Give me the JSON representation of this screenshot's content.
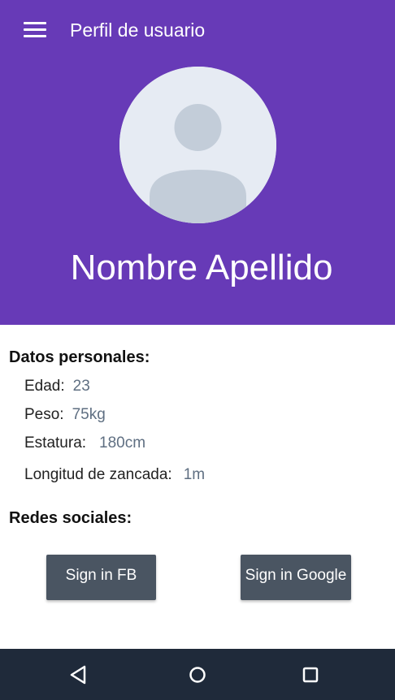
{
  "app_bar": {
    "title": "Perfil de usuario",
    "menu_icon": "hamburger-menu-icon"
  },
  "profile": {
    "name": "Nombre Apellido",
    "avatar_icon": "default-user-avatar-icon"
  },
  "personal": {
    "heading": "Datos personales:",
    "fields": [
      {
        "label": "Edad:",
        "value": "23"
      },
      {
        "label": "Peso:",
        "value": "75kg"
      },
      {
        "label": "Estatura:",
        "value": "180cm"
      },
      {
        "label": "Longitud de zancada:",
        "value": "1m"
      }
    ]
  },
  "social": {
    "heading": "Redes sociales:",
    "fb_button": "Sign in FB",
    "google_button": "Sign in Google"
  },
  "system_nav": {
    "back_icon": "back-triangle-icon",
    "home_icon": "home-circle-icon",
    "recents_icon": "recents-square-icon"
  },
  "colors": {
    "header": "#673ab7",
    "button": "#4a5562",
    "navbar": "#1f2a3a",
    "value_text": "#5f6f82"
  }
}
